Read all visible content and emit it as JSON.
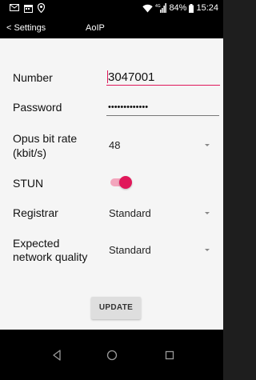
{
  "status_bar": {
    "battery_percent": "84%",
    "time": "15:24",
    "icons": [
      "notification-icon",
      "calendar-icon",
      "location-icon",
      "wifi-icon",
      "signal-icon",
      "battery-icon"
    ]
  },
  "action_bar": {
    "back_label": "Settings",
    "title": "AoIP"
  },
  "form": {
    "number": {
      "label": "Number",
      "value": "3047001"
    },
    "password": {
      "label": "Password",
      "value": "•••••••••••••"
    },
    "opus_bitrate": {
      "label_line1": "Opus bit rate",
      "label_line2": "(kbit/s)",
      "value": "48"
    },
    "stun": {
      "label": "STUN",
      "enabled": true
    },
    "registrar": {
      "label": "Registrar",
      "value": "Standard"
    },
    "network_quality": {
      "label_line1": "Expected",
      "label_line2": "network quality",
      "value": "Standard"
    }
  },
  "update_button": {
    "label": "UPDATE"
  },
  "nav_bar": {
    "icons": [
      "back-nav-icon",
      "home-nav-icon",
      "recents-nav-icon"
    ]
  },
  "colors": {
    "accent": "#e0185a",
    "accent_light": "#f3a6bd",
    "background": "#f5f5f5",
    "bars": "#000000"
  }
}
